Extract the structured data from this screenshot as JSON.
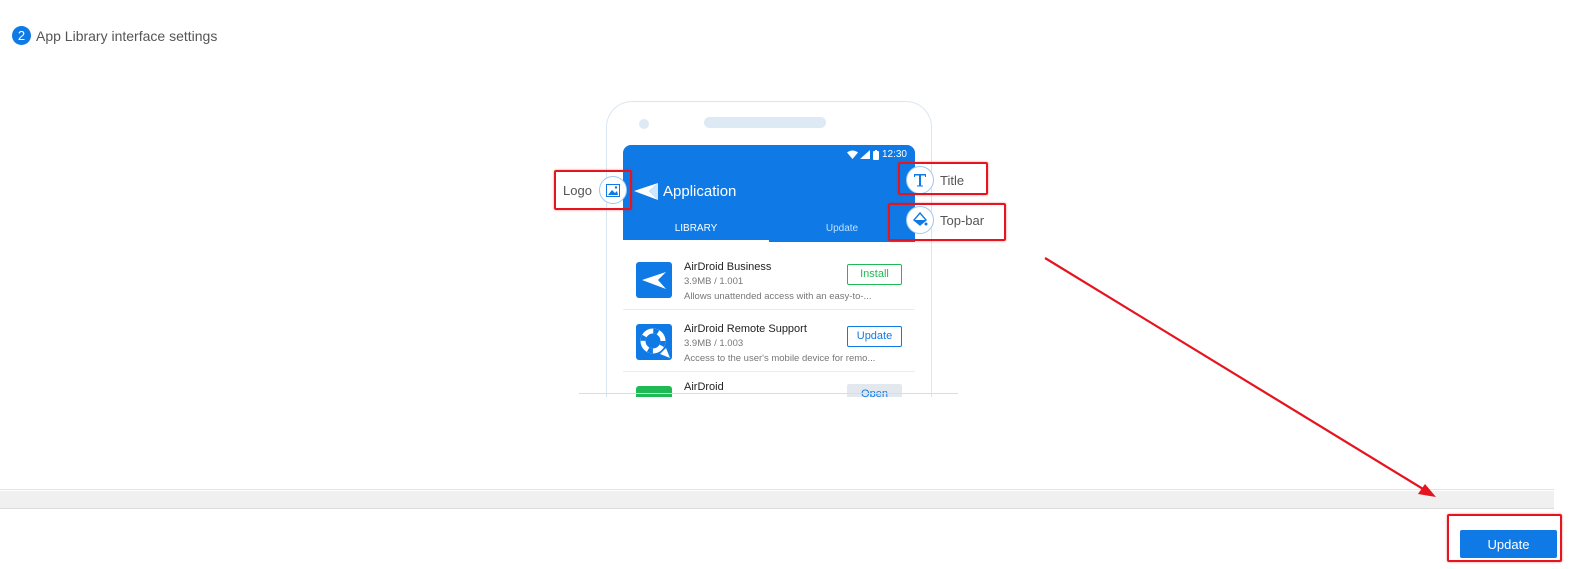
{
  "section": {
    "step_number": "2",
    "title": "App Library interface settings"
  },
  "preview": {
    "status_time": "12:30",
    "app_title": "Application",
    "tabs": [
      {
        "label": "LIBRARY",
        "active": true
      },
      {
        "label": "Update",
        "active": false
      }
    ],
    "apps": [
      {
        "name": "AirDroid Business",
        "size": "3.9MB / 1.001",
        "description": "Allows unattended access with an easy-to-...",
        "action": "Install"
      },
      {
        "name": "AirDroid Remote Support",
        "size": "3.9MB / 1.003",
        "description": "Access to the user's mobile device for remo...",
        "action": "Update"
      },
      {
        "name": "AirDroid",
        "size": "",
        "description": "",
        "action": "Open"
      }
    ]
  },
  "callouts": {
    "logo": "Logo",
    "title": "Title",
    "topbar": "Top-bar"
  },
  "footer": {
    "update_label": "Update"
  },
  "colors": {
    "accent": "#0f7ae5",
    "highlight": "#e5151f",
    "install": "#1fb955"
  }
}
